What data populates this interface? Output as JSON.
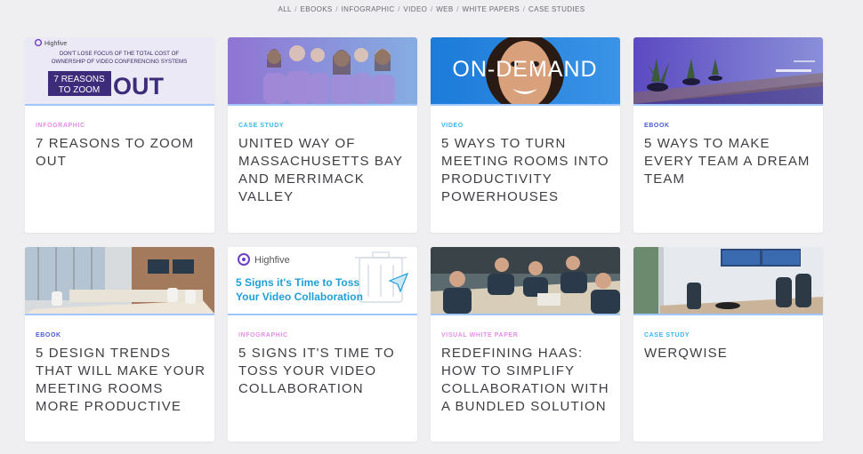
{
  "filters": [
    "ALL",
    "EBOOKS",
    "INFOGRAPHIC",
    "VIDEO",
    "WEB",
    "WHITE PAPERS",
    "CASE STUDIES"
  ],
  "colors": {
    "infographic": "#e58ee8",
    "case_study": "#38b6ea",
    "video": "#38b6ea",
    "ebook": "#4a5bd8",
    "visual_white_paper": "#e58ee8",
    "brand_purple": "#3c2c7a",
    "accent_line": "#9fc6ff"
  },
  "cards": [
    {
      "type": "INFOGRAPHIC",
      "title": "7 REASONS TO ZOOM OUT",
      "thumb": {
        "brand": "Highfive",
        "headline_1": "DON'T LOSE FOCUS OF THE TOTAL COST OF",
        "headline_2": "OWNERSHIP OF VIDEO CONFERENCING SYSTEMS",
        "badge_1": "7 REASONS",
        "badge_2": "TO ZOOM",
        "big_word": "OUT"
      }
    },
    {
      "type": "CASE STUDY",
      "title": "UNITED WAY OF MASSACHUSETTS BAY AND MERRIMACK VALLEY"
    },
    {
      "type": "VIDEO",
      "title": "5 WAYS TO TURN MEETING ROOMS INTO PRODUCTIVITY POWERHOUSES",
      "thumb": {
        "overlay": "ON-DEMAND"
      }
    },
    {
      "type": "EBOOK",
      "title": "5 WAYS TO MAKE EVERY TEAM A DREAM TEAM"
    },
    {
      "type": "EBOOK",
      "title": "5 DESIGN TRENDS THAT WILL MAKE YOUR MEETING ROOMS MORE PRODUCTIVE"
    },
    {
      "type": "INFOGRAPHIC",
      "title": "5 SIGNS IT'S TIME TO TOSS YOUR VIDEO COLLABORATION",
      "thumb": {
        "brand": "Highfive",
        "line_1": "5 Signs it's Time to Toss",
        "line_2": "Your Video Collaboration"
      }
    },
    {
      "type": "VISUAL WHITE PAPER",
      "title": "REDEFINING HAAS: HOW TO SIMPLIFY COLLABORATION WITH A BUNDLED SOLUTION"
    },
    {
      "type": "CASE STUDY",
      "title": "WERQWISE"
    }
  ]
}
